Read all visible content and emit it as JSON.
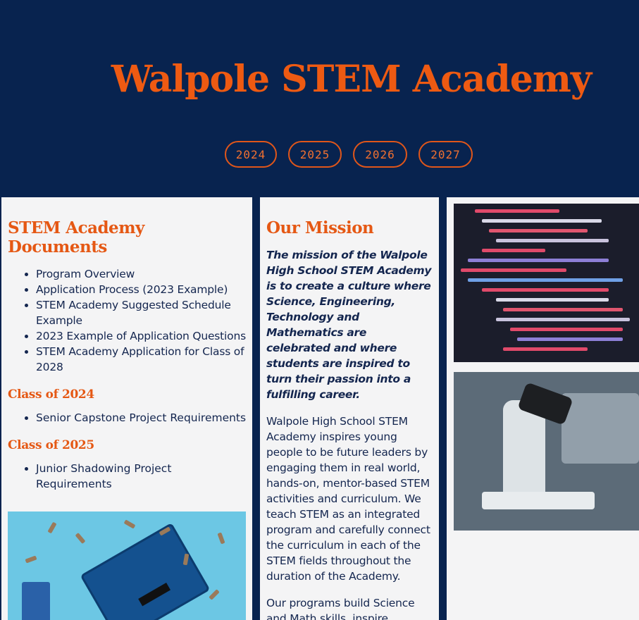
{
  "header": {
    "title": "Walpole STEM Academy",
    "years": [
      "2024",
      "2025",
      "2026",
      "2027"
    ]
  },
  "documents": {
    "heading": "STEM Academy Documents",
    "items": [
      "Program Overview",
      "Application Process (2023 Example)",
      "STEM Academy Suggested Schedule Example",
      "2023 Example of Application Questions",
      "STEM Academy Application for Class of 2028"
    ],
    "class2024": {
      "heading": "Class of 2024",
      "items": [
        "Senior Capstone Project Requirements"
      ]
    },
    "class2025": {
      "heading": "Class of 2025",
      "items": [
        "Junior Shadowing Project Requirements"
      ]
    }
  },
  "mission": {
    "heading": "Our Mission",
    "statement": "The mission of the Walpole High School STEM Academy is to create a culture where Science, Engineering, Technology and Mathematics are celebrated and where students are inspired to turn their passion into a fulfilling career.",
    "paragraph1": "Walpole High School STEM Academy inspires young people to be future leaders by engaging them in real world, hands-on, mentor-based STEM activities and curriculum. We teach STEM as an integrated program and carefully connect the curriculum in each of the STEM fields throughout the duration of the Academy.",
    "paragraph2": "Our programs build Science and Math skills, inspire"
  },
  "colors": {
    "navy": "#08234f",
    "orange": "#ee5a12",
    "panel": "#f4f4f5"
  }
}
